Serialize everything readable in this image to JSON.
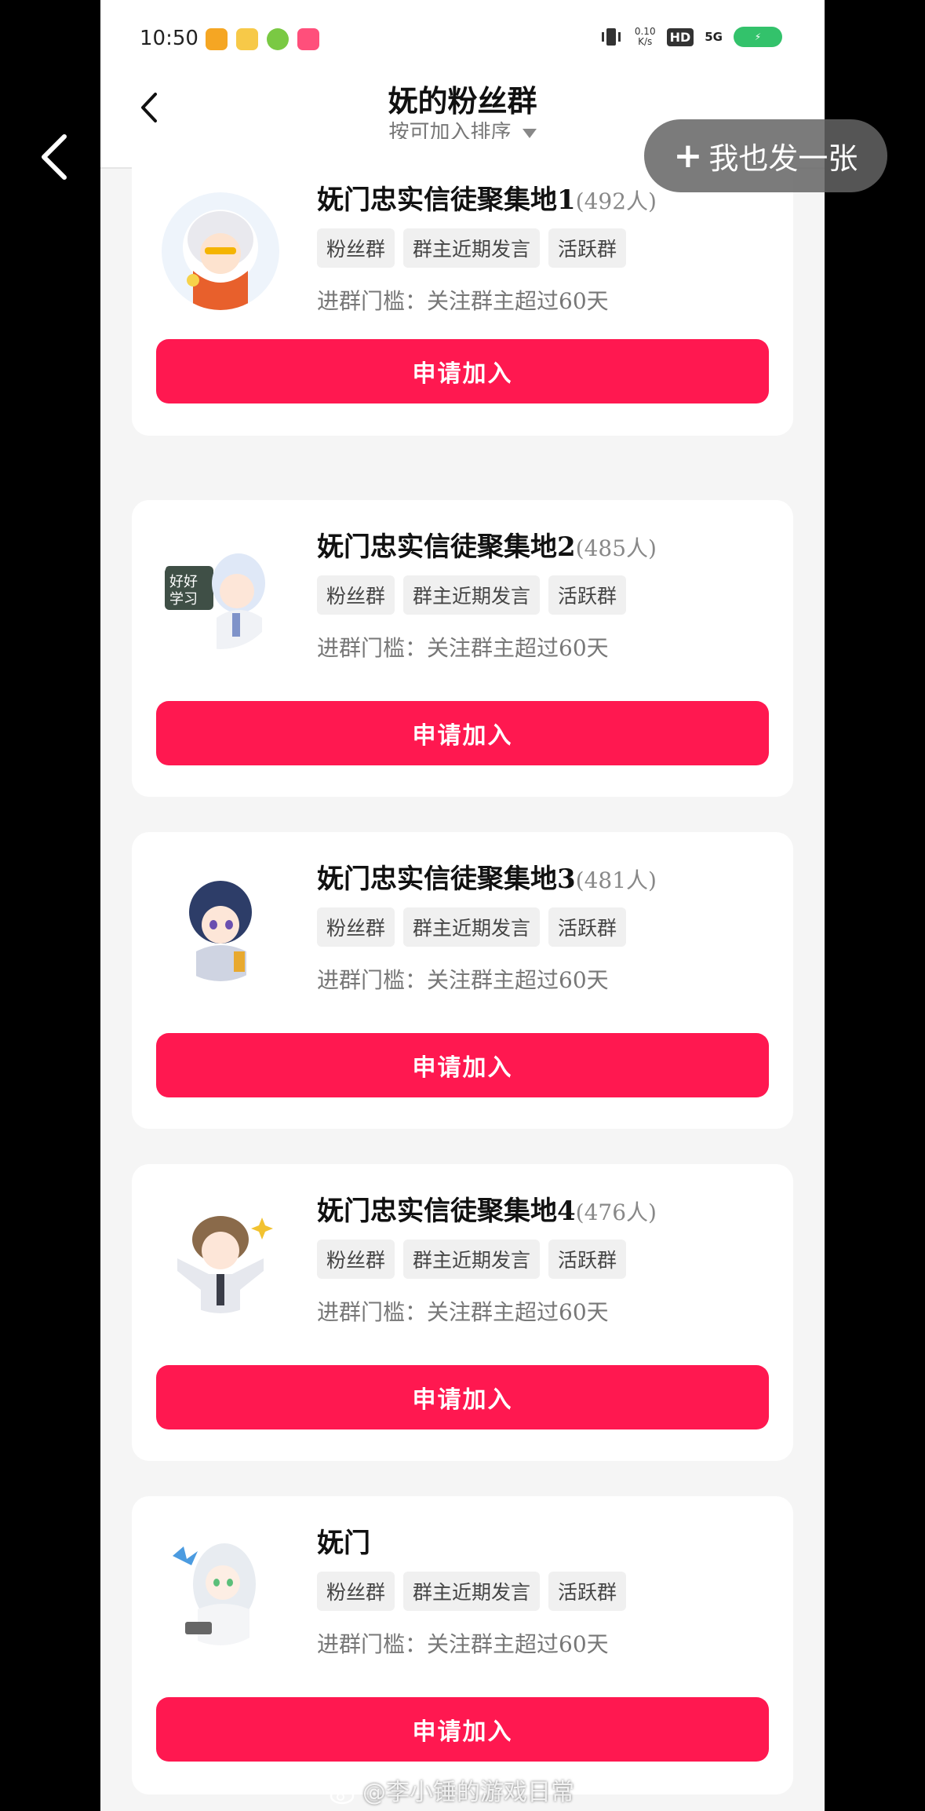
{
  "viewer": {
    "share_button_label": "我也发一张",
    "watermark": "@李小锤的游戏日常"
  },
  "status_bar": {
    "time": "10:50",
    "net_speed_value": "0.10",
    "net_speed_unit": "K/s",
    "hd": "HD",
    "network": "5G"
  },
  "header": {
    "title": "妩的粉丝群",
    "sort_label": "按可加入排序"
  },
  "colors": {
    "accent": "#ff1850",
    "tag_bg": "#f0f0f0",
    "page_bg": "#f5f5f5"
  },
  "groups": [
    {
      "name": "妩门忠实信徒聚集地1",
      "count": "(492人)",
      "tags": [
        "粉丝群",
        "群主近期发言",
        "活跃群"
      ],
      "threshold": "进群门槛：关注群主超过60天",
      "button": "申请加入"
    },
    {
      "name": "妩门忠实信徒聚集地2",
      "count": "(485人)",
      "tags": [
        "粉丝群",
        "群主近期发言",
        "活跃群"
      ],
      "threshold": "进群门槛：关注群主超过60天",
      "button": "申请加入"
    },
    {
      "name": "妩门忠实信徒聚集地3",
      "count": "(481人)",
      "tags": [
        "粉丝群",
        "群主近期发言",
        "活跃群"
      ],
      "threshold": "进群门槛：关注群主超过60天",
      "button": "申请加入"
    },
    {
      "name": "妩门忠实信徒聚集地4",
      "count": "(476人)",
      "tags": [
        "粉丝群",
        "群主近期发言",
        "活跃群"
      ],
      "threshold": "进群门槛：关注群主超过60天",
      "button": "申请加入"
    },
    {
      "name": "妩门",
      "count": "",
      "tags": [
        "粉丝群",
        "群主近期发言",
        "活跃群"
      ],
      "threshold": "进群门槛：关注群主超过60天",
      "button": "申请加入"
    }
  ]
}
